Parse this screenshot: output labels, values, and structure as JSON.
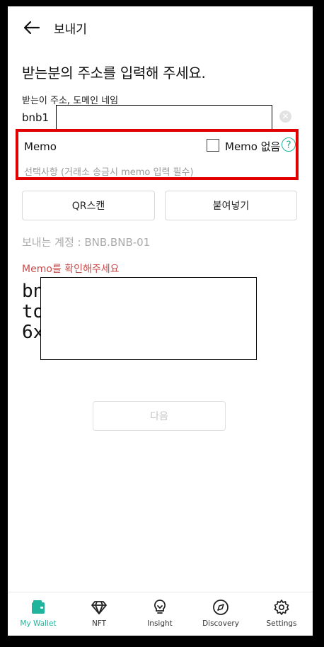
{
  "header": {
    "title": "보내기"
  },
  "heading": "받는분의 주소를 입력해 주세요.",
  "address": {
    "label": "받는이 주소, 도메인 네임",
    "prefix": "bnb1",
    "suffix": ".",
    "clear_icon": "close-circle-icon"
  },
  "memo": {
    "label": "Memo",
    "no_memo_label": "Memo 없음",
    "no_memo_checked": false,
    "help_symbol": "?",
    "placeholder": "선택사항 (거래소 송금시 memo 입력 필수)"
  },
  "buttons": {
    "qr": "QR스캔",
    "paste": "붙여넣기",
    "next": "다음"
  },
  "account_label": "보내는 계정 : BNB.BNB-01",
  "memo_warning": "Memo를 확인해주세요",
  "big_lines": [
    "bn",
    "to",
    "6x"
  ],
  "tabs": [
    {
      "label": "My Wallet",
      "icon": "wallet-icon",
      "active": true
    },
    {
      "label": "NFT",
      "icon": "diamond-icon",
      "active": false
    },
    {
      "label": "Insight",
      "icon": "lightbulb-icon",
      "active": false
    },
    {
      "label": "Discovery",
      "icon": "compass-icon",
      "active": false
    },
    {
      "label": "Settings",
      "icon": "gear-icon",
      "active": false
    }
  ],
  "colors": {
    "accent": "#1fb49b",
    "warning": "#c84b4b",
    "highlight_border": "#e00000"
  }
}
